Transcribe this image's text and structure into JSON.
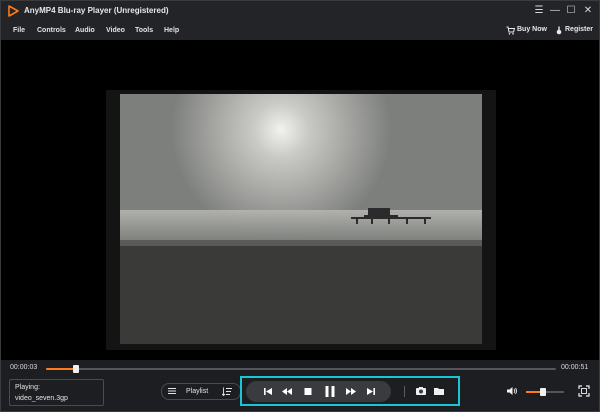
{
  "app": {
    "title": "AnyMP4 Blu-ray Player (Unregistered)"
  },
  "window_controls": {
    "menu_glyph": "☰",
    "minimize_glyph": "—",
    "maximize_glyph": "☐",
    "close_glyph": "✕"
  },
  "menu": {
    "items": [
      "File",
      "Controls",
      "Audio",
      "Video",
      "Tools",
      "Help"
    ],
    "buy_now": "Buy Now",
    "register": "Register"
  },
  "playback": {
    "current_time": "00:00:03",
    "total_time": "00:00:51",
    "progress_fraction": 0.059,
    "playing_label": "Playing:",
    "file_name": "video_seven.3gp"
  },
  "playlist": {
    "label": "Playlist"
  },
  "volume": {
    "level_fraction": 0.45
  },
  "colors": {
    "accent": "#ff7a1a",
    "highlight": "#19c7d4",
    "background": "#1f2023",
    "video_background": "#000000"
  },
  "icons": {
    "logo": "play-triangle-logo",
    "buy": "cart-icon",
    "register": "key-icon",
    "transport": [
      "skip-previous-icon",
      "rewind-icon",
      "stop-icon",
      "pause-icon",
      "fast-forward-icon",
      "skip-next-icon"
    ],
    "snapshot": "camera-icon",
    "open": "folder-icon",
    "volume": "speaker-icon",
    "fullscreen": "fullscreen-icon"
  }
}
